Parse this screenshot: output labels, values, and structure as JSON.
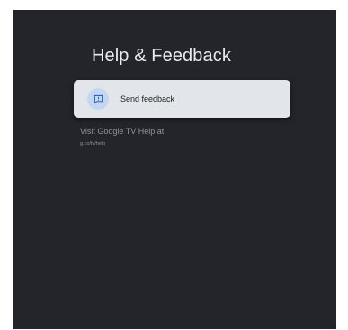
{
  "panel": {
    "title": "Help & Feedback"
  },
  "feedback_item": {
    "label": "Send feedback",
    "icon": "feedback-icon",
    "icon_bg": "#c3d7f0",
    "icon_color": "#1a56c8"
  },
  "help_info": {
    "text": "Visit Google TV Help at",
    "url": "g.co/tv/help"
  },
  "colors": {
    "background": "#23252b",
    "focused_item": "#e2e5e9",
    "secondary_text": "#8f949b"
  }
}
